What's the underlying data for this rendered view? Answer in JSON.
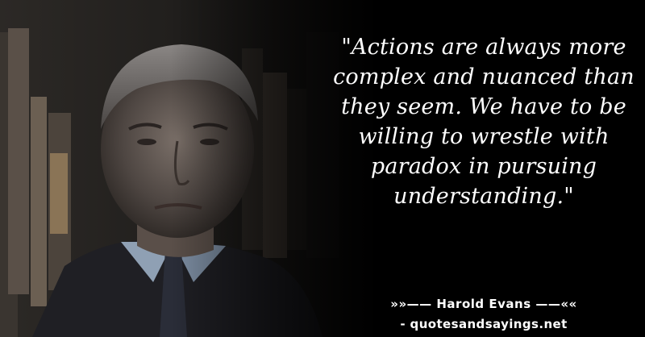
{
  "quote": {
    "text": "\"Actions are always more complex and nuanced than they seem. We have to be willing to wrestle with paradox in pursuing understanding.\""
  },
  "attribution": {
    "author_line": "»»—— Harold Evans ——««",
    "website": "- quotesandsayings.net"
  },
  "colors": {
    "background": "#000000",
    "text": "#ffffff"
  }
}
